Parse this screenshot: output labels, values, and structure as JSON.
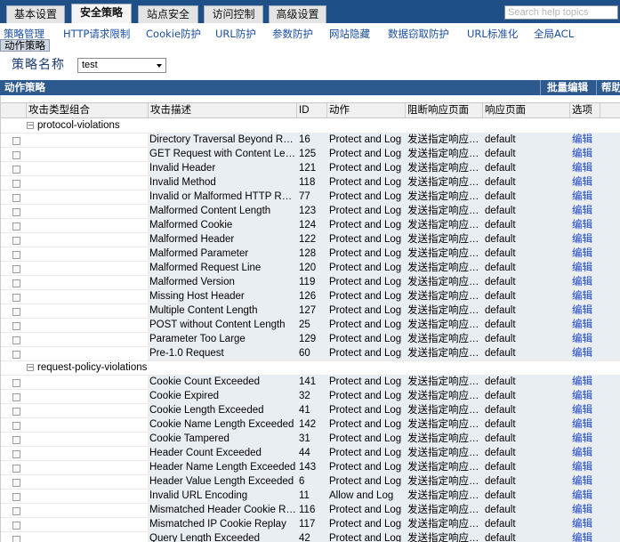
{
  "top_tabs": [
    {
      "label": "基本设置",
      "active": false
    },
    {
      "label": "安全策略",
      "active": true
    },
    {
      "label": "站点安全",
      "active": false
    },
    {
      "label": "访问控制",
      "active": false
    },
    {
      "label": "高级设置",
      "active": false
    }
  ],
  "search": {
    "placeholder": "Search help topics"
  },
  "submenu": [
    "策略管理",
    "HTTP请求限制",
    "Cookie防护",
    "URL防护",
    "参数防护",
    "网站隐藏",
    "数据窃取防护",
    "URL标准化",
    "全局ACL"
  ],
  "breadcrumb": "动作策略",
  "policy": {
    "label": "策略名称",
    "selected": "test"
  },
  "section": {
    "title": "动作策略",
    "batch_edit": "批量编辑",
    "help": "帮助"
  },
  "columns": [
    "攻击类型组合",
    "攻击描述",
    "ID",
    "动作",
    "阻断响应页面",
    "响应页面",
    "选项"
  ],
  "groups": [
    {
      "name": "protocol-violations",
      "rows": [
        {
          "desc": "Directory Traversal Beyond Root",
          "id": "16",
          "action": "Protect and Log",
          "block_page": "发送指定响应页面",
          "response_page": "default",
          "option": "编辑"
        },
        {
          "desc": "GET Request with Content Length",
          "id": "125",
          "action": "Protect and Log",
          "block_page": "发送指定响应页面",
          "response_page": "default",
          "option": "编辑"
        },
        {
          "desc": "Invalid Header",
          "id": "121",
          "action": "Protect and Log",
          "block_page": "发送指定响应页面",
          "response_page": "default",
          "option": "编辑"
        },
        {
          "desc": "Invalid Method",
          "id": "118",
          "action": "Protect and Log",
          "block_page": "发送指定响应页面",
          "response_page": "default",
          "option": "编辑"
        },
        {
          "desc": "Invalid or Malformed HTTP Request",
          "id": "77",
          "action": "Protect and Log",
          "block_page": "发送指定响应页面",
          "response_page": "default",
          "option": "编辑"
        },
        {
          "desc": "Malformed Content Length",
          "id": "123",
          "action": "Protect and Log",
          "block_page": "发送指定响应页面",
          "response_page": "default",
          "option": "编辑"
        },
        {
          "desc": "Malformed Cookie",
          "id": "124",
          "action": "Protect and Log",
          "block_page": "发送指定响应页面",
          "response_page": "default",
          "option": "编辑"
        },
        {
          "desc": "Malformed Header",
          "id": "122",
          "action": "Protect and Log",
          "block_page": "发送指定响应页面",
          "response_page": "default",
          "option": "编辑"
        },
        {
          "desc": "Malformed Parameter",
          "id": "128",
          "action": "Protect and Log",
          "block_page": "发送指定响应页面",
          "response_page": "default",
          "option": "编辑"
        },
        {
          "desc": "Malformed Request Line",
          "id": "120",
          "action": "Protect and Log",
          "block_page": "发送指定响应页面",
          "response_page": "default",
          "option": "编辑"
        },
        {
          "desc": "Malformed Version",
          "id": "119",
          "action": "Protect and Log",
          "block_page": "发送指定响应页面",
          "response_page": "default",
          "option": "编辑"
        },
        {
          "desc": "Missing Host Header",
          "id": "126",
          "action": "Protect and Log",
          "block_page": "发送指定响应页面",
          "response_page": "default",
          "option": "编辑"
        },
        {
          "desc": "Multiple Content Length",
          "id": "127",
          "action": "Protect and Log",
          "block_page": "发送指定响应页面",
          "response_page": "default",
          "option": "编辑"
        },
        {
          "desc": "POST without Content Length",
          "id": "25",
          "action": "Protect and Log",
          "block_page": "发送指定响应页面",
          "response_page": "default",
          "option": "编辑"
        },
        {
          "desc": "Parameter Too Large",
          "id": "129",
          "action": "Protect and Log",
          "block_page": "发送指定响应页面",
          "response_page": "default",
          "option": "编辑"
        },
        {
          "desc": "Pre-1.0 Request",
          "id": "60",
          "action": "Protect and Log",
          "block_page": "发送指定响应页面",
          "response_page": "default",
          "option": "编辑"
        }
      ]
    },
    {
      "name": "request-policy-violations",
      "rows": [
        {
          "desc": "Cookie Count Exceeded",
          "id": "141",
          "action": "Protect and Log",
          "block_page": "发送指定响应页面",
          "response_page": "default",
          "option": "编辑"
        },
        {
          "desc": "Cookie Expired",
          "id": "32",
          "action": "Protect and Log",
          "block_page": "发送指定响应页面",
          "response_page": "default",
          "option": "编辑"
        },
        {
          "desc": "Cookie Length Exceeded",
          "id": "41",
          "action": "Protect and Log",
          "block_page": "发送指定响应页面",
          "response_page": "default",
          "option": "编辑"
        },
        {
          "desc": "Cookie Name Length Exceeded",
          "id": "142",
          "action": "Protect and Log",
          "block_page": "发送指定响应页面",
          "response_page": "default",
          "option": "编辑"
        },
        {
          "desc": "Cookie Tampered",
          "id": "31",
          "action": "Protect and Log",
          "block_page": "发送指定响应页面",
          "response_page": "default",
          "option": "编辑"
        },
        {
          "desc": "Header Count Exceeded",
          "id": "44",
          "action": "Protect and Log",
          "block_page": "发送指定响应页面",
          "response_page": "default",
          "option": "编辑"
        },
        {
          "desc": "Header Name Length Exceeded",
          "id": "143",
          "action": "Protect and Log",
          "block_page": "发送指定响应页面",
          "response_page": "default",
          "option": "编辑"
        },
        {
          "desc": "Header Value Length Exceeded",
          "id": "6",
          "action": "Protect and Log",
          "block_page": "发送指定响应页面",
          "response_page": "default",
          "option": "编辑"
        },
        {
          "desc": "Invalid URL Encoding",
          "id": "11",
          "action": "Allow and Log",
          "block_page": "发送指定响应页面",
          "response_page": "default",
          "option": "编辑"
        },
        {
          "desc": "Mismatched Header Cookie Replay",
          "id": "116",
          "action": "Protect and Log",
          "block_page": "发送指定响应页面",
          "response_page": "default",
          "option": "编辑"
        },
        {
          "desc": "Mismatched IP Cookie Replay",
          "id": "117",
          "action": "Protect and Log",
          "block_page": "发送指定响应页面",
          "response_page": "default",
          "option": "编辑"
        },
        {
          "desc": "Query Length Exceeded",
          "id": "42",
          "action": "Protect and Log",
          "block_page": "发送指定响应页面",
          "response_page": "default",
          "option": "编辑"
        }
      ]
    }
  ]
}
